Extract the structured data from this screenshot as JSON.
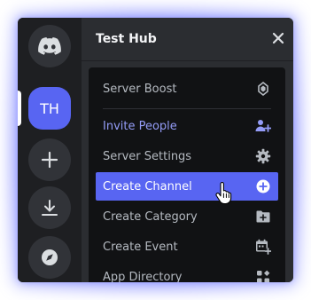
{
  "rail": {
    "server_initials": "TH"
  },
  "header": {
    "title": "Test Hub"
  },
  "menu": {
    "items": [
      {
        "label": "Server Boost",
        "icon": "boost-icon"
      },
      {
        "label": "Invite People",
        "icon": "invite-people-icon"
      },
      {
        "label": "Server Settings",
        "icon": "gear-icon"
      },
      {
        "label": "Create Channel",
        "icon": "plus-circle-icon"
      },
      {
        "label": "Create Category",
        "icon": "folder-plus-icon"
      },
      {
        "label": "Create Event",
        "icon": "calendar-plus-icon"
      },
      {
        "label": "App Directory",
        "icon": "apps-icon"
      }
    ]
  },
  "colors": {
    "accent": "#5865f2",
    "invite": "#949cf7",
    "menu_bg": "#111214",
    "rail_bg": "#1e1f22",
    "panel_bg": "#2b2d31"
  }
}
